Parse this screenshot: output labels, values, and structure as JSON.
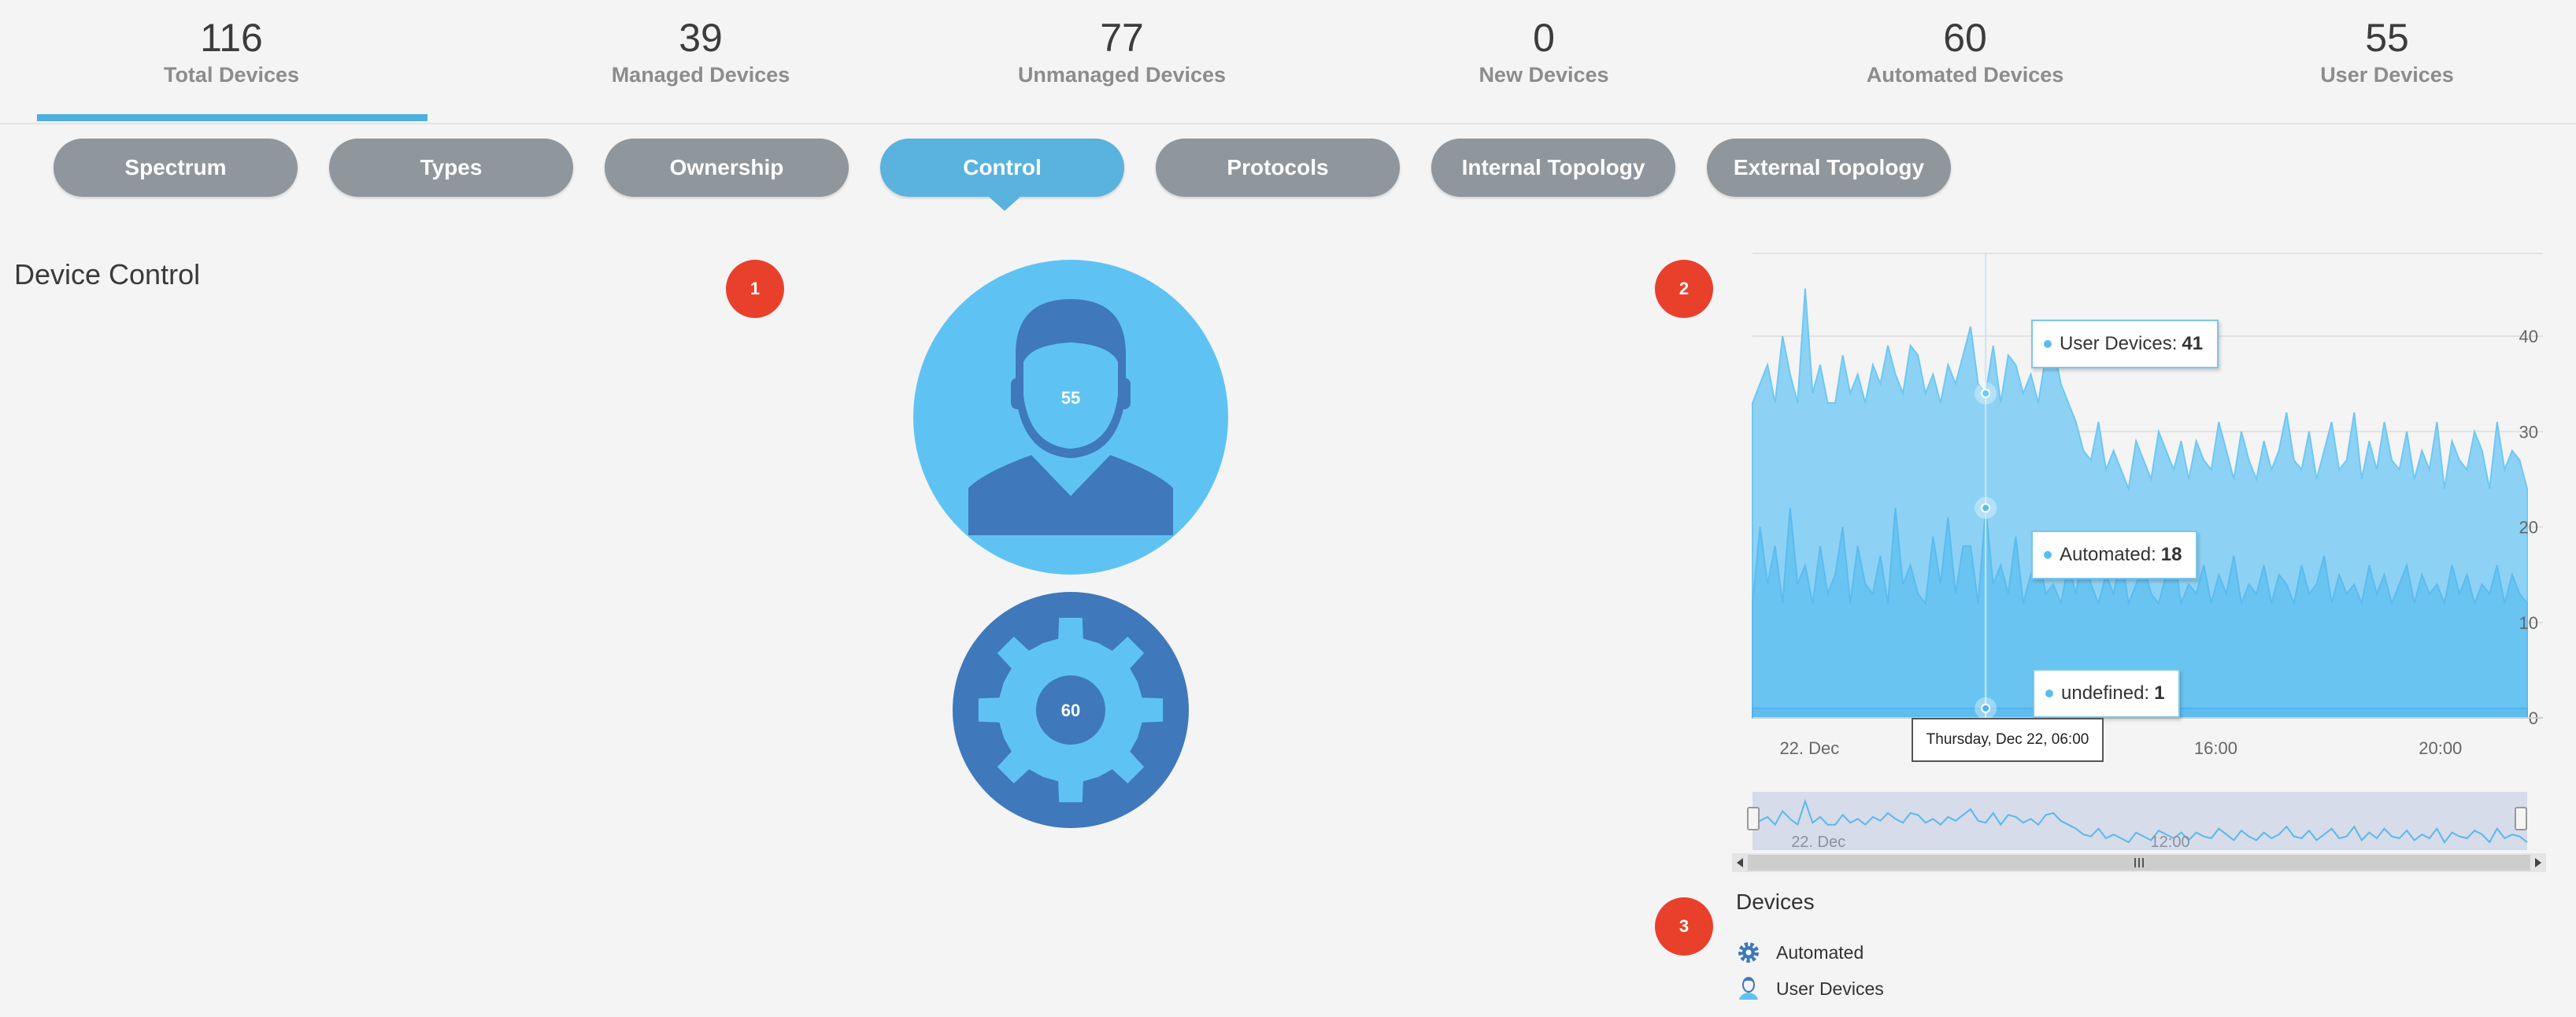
{
  "stats": [
    {
      "value": "116",
      "label": "Total Devices"
    },
    {
      "value": "39",
      "label": "Managed Devices"
    },
    {
      "value": "77",
      "label": "Unmanaged Devices"
    },
    {
      "value": "0",
      "label": "New Devices"
    },
    {
      "value": "60",
      "label": "Automated Devices"
    },
    {
      "value": "55",
      "label": "User Devices"
    }
  ],
  "tabs": [
    "Spectrum",
    "Types",
    "Ownership",
    "Control",
    "Protocols",
    "Internal Topology",
    "External Topology"
  ],
  "active_tab": "Control",
  "section_title": "Device Control",
  "badges": [
    "1",
    "2",
    "3"
  ],
  "user_circle_count": "55",
  "automated_circle_count": "60",
  "colors": {
    "accent": "#4fb0de",
    "tab_inactive": "#8f969c",
    "badge": "#e9402c",
    "user_light": "#5ec3f3",
    "user_dark": "#3f78bb",
    "series_fill": "#6cc6f3"
  },
  "tooltips": {
    "user": {
      "label": "User Devices:",
      "value": "41"
    },
    "automated": {
      "label": "Automated:",
      "value": "18"
    },
    "undefined": {
      "label": "undefined:",
      "value": "1"
    },
    "date": "Thursday, Dec 22, 06:00"
  },
  "chart_data": {
    "type": "area",
    "x_ticks": [
      "22. Dec",
      "12:00",
      "16:00",
      "20:00"
    ],
    "y_ticks": [
      0,
      10,
      20,
      30,
      40
    ],
    "ylim": [
      0,
      48
    ],
    "series": [
      {
        "name": "User Devices",
        "values": [
          33,
          35,
          37,
          33,
          40,
          36,
          33,
          45,
          34,
          37,
          33,
          33,
          38,
          34,
          36,
          33,
          37,
          35,
          39,
          36,
          34,
          39,
          38,
          34,
          36,
          33,
          37,
          35,
          38,
          41,
          35,
          34,
          39,
          33,
          38,
          37,
          34,
          36,
          33,
          38,
          39,
          35,
          33,
          31,
          28,
          27,
          31,
          26,
          28,
          26,
          24,
          29,
          27,
          25,
          30,
          28,
          26,
          29,
          25,
          29,
          27,
          26,
          31,
          28,
          25,
          30,
          27,
          25,
          29,
          26,
          28,
          32,
          27,
          26,
          30,
          25,
          28,
          31,
          26,
          27,
          32,
          25,
          29,
          26,
          31,
          27,
          26,
          30,
          25,
          28,
          26,
          31,
          24,
          29,
          27,
          26,
          30,
          28,
          24,
          31,
          26,
          28,
          27,
          24
        ]
      },
      {
        "name": "Automated",
        "values": [
          12,
          20,
          14,
          18,
          12,
          22,
          14,
          16,
          12,
          18,
          13,
          15,
          20,
          12,
          18,
          14,
          13,
          17,
          12,
          22,
          14,
          16,
          13,
          12,
          19,
          14,
          21,
          13,
          18,
          18,
          12,
          22,
          14,
          16,
          13,
          19,
          12,
          15,
          17,
          13,
          14,
          12,
          16,
          13,
          18,
          14,
          12,
          15,
          13,
          17,
          12,
          14,
          16,
          13,
          12,
          15,
          17,
          12,
          14,
          13,
          16,
          12,
          15,
          13,
          17,
          12,
          14,
          13,
          16,
          12,
          15,
          14,
          12,
          16,
          13,
          14,
          17,
          12,
          15,
          13,
          14,
          12,
          16,
          13,
          15,
          12,
          14,
          16,
          12,
          15,
          13,
          14,
          12,
          16,
          13,
          15,
          12,
          14,
          13,
          16,
          12,
          15,
          13,
          12
        ]
      },
      {
        "name": "undefined",
        "values": [
          1,
          1,
          1,
          1,
          1,
          1,
          1,
          1,
          1,
          1,
          1,
          1,
          1,
          1,
          1,
          1,
          1,
          1,
          1,
          1,
          1,
          1,
          1,
          1,
          1,
          1,
          1,
          1,
          1,
          1,
          1,
          1,
          1,
          1,
          1,
          1,
          1,
          1,
          1,
          1,
          1,
          1,
          1,
          1,
          1,
          1,
          1,
          1,
          1,
          1,
          1,
          1,
          1,
          1,
          1,
          1,
          1,
          1,
          1,
          1,
          1,
          1,
          1,
          1,
          1,
          1,
          1,
          1,
          1,
          1,
          1,
          1,
          1,
          1,
          1,
          1,
          1,
          1,
          1,
          1,
          1,
          1,
          1,
          1,
          1,
          1,
          1,
          1,
          1,
          1,
          1,
          1,
          1,
          1,
          1,
          1,
          1,
          1,
          1,
          1,
          1,
          1,
          1,
          1
        ]
      }
    ],
    "navigator_ticks": [
      "22. Dec",
      "12:00"
    ],
    "grid": true
  },
  "legend": {
    "title": "Devices",
    "items": [
      {
        "label": "Automated",
        "icon": "gear-icon"
      },
      {
        "label": "User Devices",
        "icon": "user-icon"
      }
    ]
  }
}
